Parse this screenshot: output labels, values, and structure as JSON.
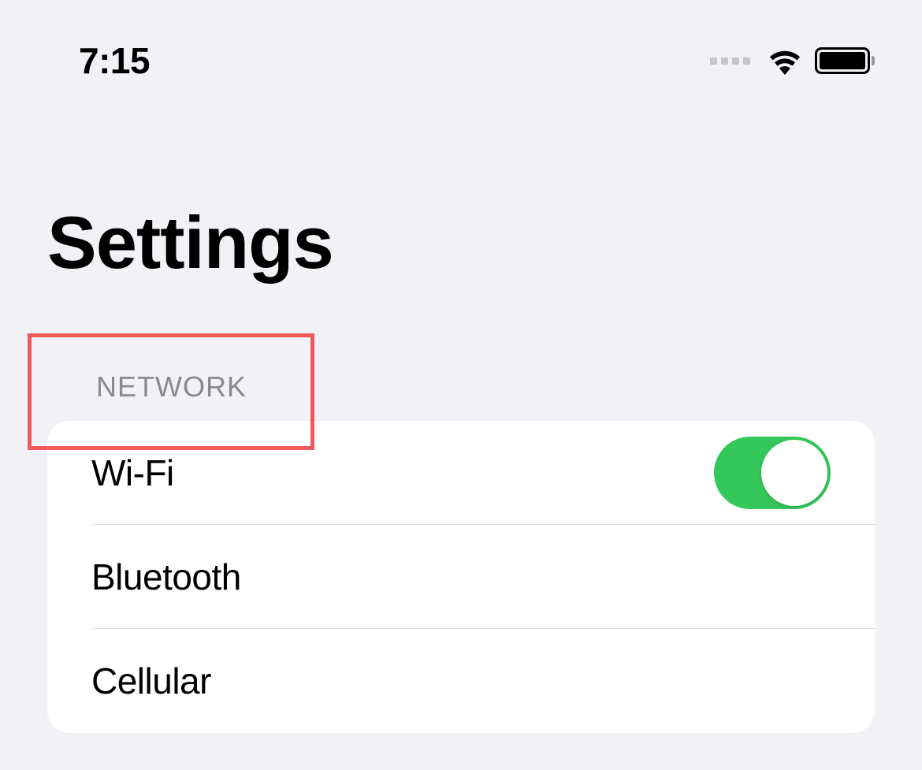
{
  "status": {
    "time": "7:15"
  },
  "page": {
    "title": "Settings"
  },
  "section": {
    "header": "NETWORK",
    "items": [
      {
        "label": "Wi-Fi",
        "toggle": true,
        "on": true
      },
      {
        "label": "Bluetooth"
      },
      {
        "label": "Cellular"
      }
    ]
  },
  "colors": {
    "accent_green": "#34c759",
    "highlight_red": "#ee5959"
  }
}
